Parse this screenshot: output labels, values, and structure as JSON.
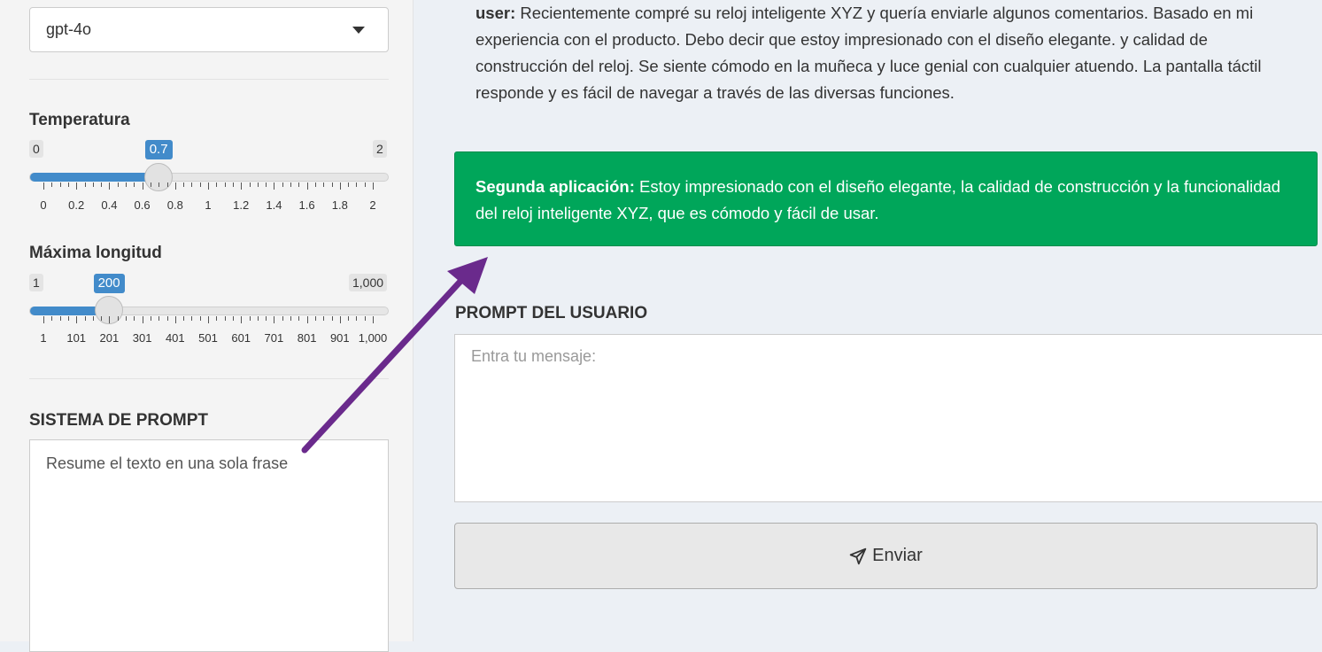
{
  "sidebar": {
    "model_select": {
      "value": "gpt-4o"
    },
    "temperature": {
      "label": "Temperatura",
      "min": "0",
      "max": "2",
      "value": "0.7",
      "value_num": 0.7,
      "range": [
        0,
        2
      ],
      "ticks": [
        "0",
        "0.2",
        "0.4",
        "0.6",
        "0.8",
        "1",
        "1.2",
        "1.4",
        "1.6",
        "1.8",
        "2"
      ]
    },
    "max_length": {
      "label": "Máxima longitud",
      "min": "1",
      "max": "1,000",
      "value": "200",
      "value_num": 200,
      "range": [
        1,
        1000
      ],
      "ticks": [
        "1",
        "101",
        "201",
        "301",
        "401",
        "501",
        "601",
        "701",
        "801",
        "901",
        "1,000"
      ]
    },
    "system_prompt": {
      "label": "SISTEMA DE PROMPT",
      "value": "Resume el texto en una sola frase"
    }
  },
  "chat": {
    "user_message": {
      "role": "user:",
      "text": "Recientemente compré su reloj inteligente XYZ y quería enviarle algunos comentarios. Basado en mi experiencia con el producto. Debo decir que estoy impresionado con el diseño elegante. y calidad de construcción del reloj. Se siente cómodo en la muñeca y luce genial con cualquier atuendo. La pantalla táctil responde y es fácil de navegar a través de las diversas funciones."
    },
    "assistant_message": {
      "role": "Segunda aplicación:",
      "text": "Estoy impresionado con el diseño elegante, la calidad de construcción y la funcionalidad del reloj inteligente XYZ, que es cómodo y fácil de usar."
    }
  },
  "user_prompt": {
    "label": "PROMPT DEL USUARIO",
    "placeholder": "Entra tu mensaje:"
  },
  "send_button": {
    "label": "Enviar",
    "icon": "paper-plane-icon"
  },
  "colors": {
    "accent": "#428bca",
    "success": "#00a65a",
    "annotation_arrow": "#6a2a8c"
  }
}
